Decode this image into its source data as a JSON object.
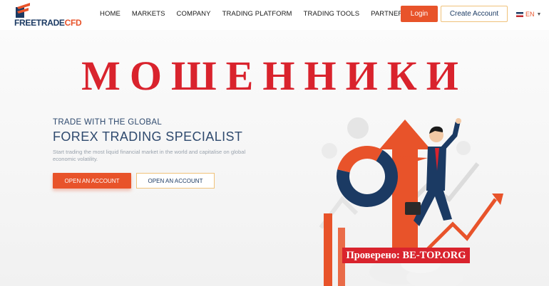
{
  "header": {
    "logo": {
      "part1": "FREETRADE",
      "part2": "CFD"
    },
    "nav": [
      "HOME",
      "MARKETS",
      "COMPANY",
      "TRADING PLATFORM",
      "TRADING TOOLS",
      "PARTNER WITH US"
    ],
    "login_label": "Login",
    "create_label": "Create Account",
    "lang_label": "EN"
  },
  "overlay": {
    "word": "МОШЕННИКИ"
  },
  "hero": {
    "subtitle": "TRADE WITH THE GLOBAL",
    "title": "FOREX TRADING SPECIALIST",
    "description": "Start trading the most liquid financial market in the world and capitalise on global economic volatility.",
    "button_primary": "OPEN AN ACCOUNT",
    "button_secondary": "OPEN AN ACCOUNT"
  },
  "watermark": {
    "text": "Проверено: BE-TOP.ORG"
  },
  "colors": {
    "accent": "#e8532a",
    "navy": "#1b3a63",
    "red": "#d9232d"
  },
  "icons": {
    "logo": "arrow-logo-icon",
    "flag": "uk-flag-icon",
    "caret": "chevron-down-icon"
  }
}
